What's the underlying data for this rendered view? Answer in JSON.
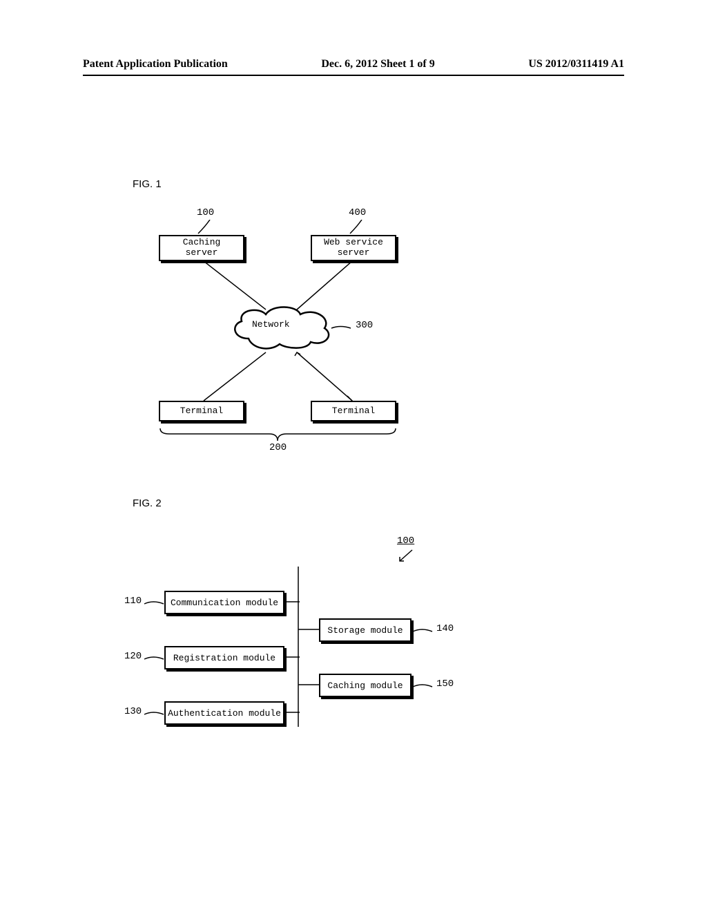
{
  "header": {
    "left": "Patent Application Publication",
    "center": "Dec. 6, 2012  Sheet 1 of 9",
    "right": "US 2012/0311419 A1"
  },
  "fig1": {
    "label": "FIG. 1",
    "caching_server_num": "100",
    "caching_server": "Caching\nserver",
    "web_service_num": "400",
    "web_service": "Web service\nserver",
    "network": "Network",
    "network_num": "300",
    "terminal": "Terminal",
    "terminals_num": "200"
  },
  "fig2": {
    "label": "FIG. 2",
    "main_num": "100",
    "n110": "110",
    "m110": "Communication module",
    "n120": "120",
    "m120": "Registration module",
    "n130": "130",
    "m130": "Authentication module",
    "n140": "140",
    "m140": "Storage module",
    "n150": "150",
    "m150": "Caching module"
  }
}
